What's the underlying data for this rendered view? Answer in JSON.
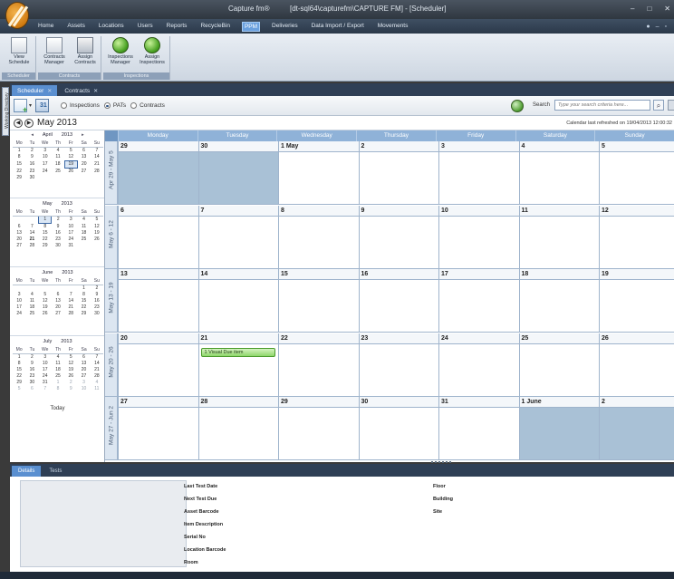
{
  "window": {
    "app_title": "Capture fm®",
    "doc_title": "[dt-sql64\\capturefm\\CAPTURE FM] - [Scheduler]"
  },
  "menu": {
    "items": [
      {
        "label": "Home",
        "active": false
      },
      {
        "label": "Assets",
        "active": false
      },
      {
        "label": "Locations",
        "active": false
      },
      {
        "label": "Users",
        "active": false
      },
      {
        "label": "Reports",
        "active": false
      },
      {
        "label": "RecycleBin",
        "active": false
      },
      {
        "label": "PPM",
        "active": true
      },
      {
        "label": "Deliveries",
        "active": false
      },
      {
        "label": "Data Import / Export",
        "active": false
      },
      {
        "label": "Movements",
        "active": false
      }
    ]
  },
  "ribbon": {
    "groups": [
      {
        "caption": "Scheduler",
        "buttons": [
          {
            "line1": "View",
            "line2": "Schedule"
          }
        ]
      },
      {
        "caption": "Contracts",
        "buttons": [
          {
            "line1": "Contracts",
            "line2": "Manager"
          },
          {
            "line1": "Assign",
            "line2": "Contracts"
          }
        ]
      },
      {
        "caption": "Inspections",
        "buttons": [
          {
            "line1": "Inspections",
            "line2": "Manager"
          },
          {
            "line1": "Assign",
            "line2": "Inspections"
          }
        ]
      }
    ]
  },
  "side_tab": "Working Directory",
  "doc_tabs": [
    {
      "label": "Scheduler",
      "active": true
    },
    {
      "label": "Contracts",
      "active": false
    }
  ],
  "toolbar": {
    "radio_inspections": "Inspections",
    "radio_pats": "PATs",
    "radio_contracts": "Contracts",
    "selected_radio": "PATs",
    "search_label": "Search",
    "search_placeholder": "Type your search criteria here..."
  },
  "month_nav": {
    "title": "May 2013",
    "refreshed": "Calendar last refreshed on 19/04/2013 12:00:32"
  },
  "mini_calendars": [
    {
      "month": "April",
      "year": "2013",
      "weeks": [
        [
          "1",
          "2",
          "3",
          "4",
          "5",
          "6",
          "7"
        ],
        [
          "8",
          "9",
          "10",
          "11",
          "12",
          "13",
          "14"
        ],
        [
          "15",
          "16",
          "17",
          "18",
          "19",
          "20",
          "21"
        ],
        [
          "22",
          "23",
          "24",
          "25",
          "26",
          "27",
          "28"
        ],
        [
          "29",
          "30",
          "",
          "",
          "",
          "",
          ""
        ]
      ],
      "selected": "19"
    },
    {
      "month": "May",
      "year": "2013",
      "weeks": [
        [
          "",
          "",
          "1",
          "2",
          "3",
          "4",
          "5"
        ],
        [
          "6",
          "7",
          "8",
          "9",
          "10",
          "11",
          "12"
        ],
        [
          "13",
          "14",
          "15",
          "16",
          "17",
          "18",
          "19"
        ],
        [
          "20",
          "21",
          "22",
          "23",
          "24",
          "25",
          "26"
        ],
        [
          "27",
          "28",
          "29",
          "30",
          "31",
          "",
          ""
        ]
      ],
      "selected": "1",
      "bold": "21"
    },
    {
      "month": "June",
      "year": "2013",
      "weeks": [
        [
          "",
          "",
          "",
          "",
          "",
          "1",
          "2"
        ],
        [
          "3",
          "4",
          "5",
          "6",
          "7",
          "8",
          "9"
        ],
        [
          "10",
          "11",
          "12",
          "13",
          "14",
          "15",
          "16"
        ],
        [
          "17",
          "18",
          "19",
          "20",
          "21",
          "22",
          "23"
        ],
        [
          "24",
          "25",
          "26",
          "27",
          "28",
          "29",
          "30"
        ]
      ]
    },
    {
      "month": "July",
      "year": "2013",
      "weeks": [
        [
          "1",
          "2",
          "3",
          "4",
          "5",
          "6",
          "7"
        ],
        [
          "8",
          "9",
          "10",
          "11",
          "12",
          "13",
          "14"
        ],
        [
          "15",
          "16",
          "17",
          "18",
          "19",
          "20",
          "21"
        ],
        [
          "22",
          "23",
          "24",
          "25",
          "26",
          "27",
          "28"
        ],
        [
          "29",
          "30",
          "31",
          "1",
          "2",
          "3",
          "4"
        ],
        [
          "5",
          "6",
          "7",
          "8",
          "9",
          "10",
          "11"
        ]
      ],
      "grey_from_row": 4
    }
  ],
  "mini_dow": [
    "Mo",
    "Tu",
    "We",
    "Th",
    "Fr",
    "Sa",
    "Su"
  ],
  "today_label": "Today",
  "calendar": {
    "dow": [
      "Monday",
      "Tuesday",
      "Wednesday",
      "Thursday",
      "Friday",
      "Saturday",
      "Sunday"
    ],
    "weeks": [
      {
        "label": "Apr 29 - May 5",
        "days": [
          {
            "num": "29",
            "off": true
          },
          {
            "num": "30",
            "off": true
          },
          {
            "num": "1 May"
          },
          {
            "num": "2"
          },
          {
            "num": "3"
          },
          {
            "num": "4"
          },
          {
            "num": "5"
          }
        ]
      },
      {
        "label": "May 6 - 12",
        "days": [
          {
            "num": "6"
          },
          {
            "num": "7"
          },
          {
            "num": "8"
          },
          {
            "num": "9"
          },
          {
            "num": "10"
          },
          {
            "num": "11"
          },
          {
            "num": "12"
          }
        ]
      },
      {
        "label": "May 13 - 19",
        "days": [
          {
            "num": "13"
          },
          {
            "num": "14"
          },
          {
            "num": "15"
          },
          {
            "num": "16"
          },
          {
            "num": "17"
          },
          {
            "num": "18"
          },
          {
            "num": "19"
          }
        ]
      },
      {
        "label": "May 20 - 26",
        "days": [
          {
            "num": "20"
          },
          {
            "num": "21",
            "event": "1 Visual Due item"
          },
          {
            "num": "22"
          },
          {
            "num": "23"
          },
          {
            "num": "24"
          },
          {
            "num": "25"
          },
          {
            "num": "26"
          }
        ]
      },
      {
        "label": "May 27 - Jun 2",
        "days": [
          {
            "num": "27"
          },
          {
            "num": "28"
          },
          {
            "num": "29"
          },
          {
            "num": "30"
          },
          {
            "num": "31"
          },
          {
            "num": "1 June",
            "off": true
          },
          {
            "num": "2",
            "off": true
          }
        ]
      }
    ]
  },
  "details_tabs": [
    {
      "label": "Details",
      "active": true
    },
    {
      "label": "Tests",
      "active": false
    }
  ],
  "details_fields_left": [
    "Last Test Date",
    "Next Test Due",
    "Asset Barcode",
    "Item Description",
    "Serial No",
    "Location Barcode",
    "Room"
  ],
  "details_fields_right": [
    "Floor",
    "Building",
    "Site"
  ],
  "colors": {
    "accent": "#5a8fd0",
    "event_green": "#8fd66a",
    "off_day": "#a9c1d6"
  }
}
